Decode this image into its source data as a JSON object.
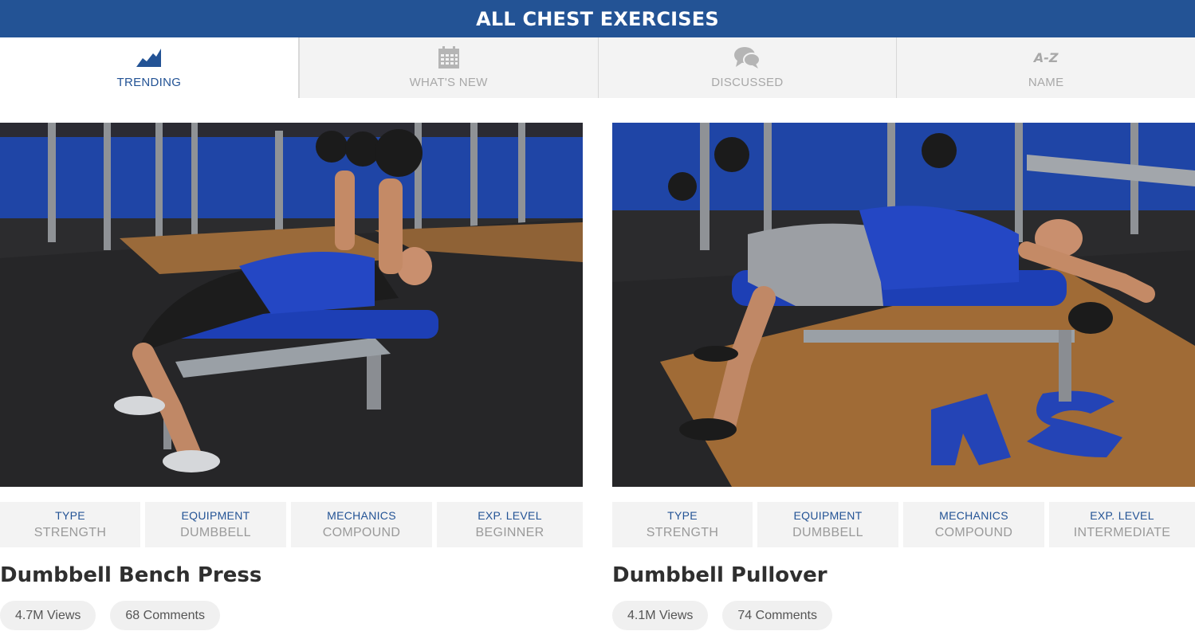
{
  "header": {
    "title": "ALL CHEST EXERCISES"
  },
  "tabs": [
    {
      "label": "TRENDING",
      "icon": "trending-chart-icon",
      "active": true
    },
    {
      "label": "WHAT'S NEW",
      "icon": "calendar-icon",
      "active": false
    },
    {
      "label": "DISCUSSED",
      "icon": "chat-bubbles-icon",
      "active": false
    },
    {
      "label": "NAME",
      "icon": "a-z-icon",
      "icon_text": "A-Z",
      "active": false
    }
  ],
  "exercises": [
    {
      "name": "Dumbbell Bench Press",
      "type_label": "TYPE",
      "type": "STRENGTH",
      "equipment_label": "EQUIPMENT",
      "equipment": "DUMBBELL",
      "mechanics_label": "MECHANICS",
      "mechanics": "COMPOUND",
      "level_label": "EXP. LEVEL",
      "level": "BEGINNER",
      "views": "4.7M Views",
      "comments": "68 Comments"
    },
    {
      "name": "Dumbbell Pullover",
      "type_label": "TYPE",
      "type": "STRENGTH",
      "equipment_label": "EQUIPMENT",
      "equipment": "DUMBBELL",
      "mechanics_label": "MECHANICS",
      "mechanics": "COMPOUND",
      "level_label": "EXP. LEVEL",
      "level": "INTERMEDIATE",
      "views": "4.1M Views",
      "comments": "74 Comments"
    }
  ],
  "colors": {
    "brand": "#235395",
    "tab_bg": "#f3f3f3",
    "muted": "#a8a8a8"
  }
}
